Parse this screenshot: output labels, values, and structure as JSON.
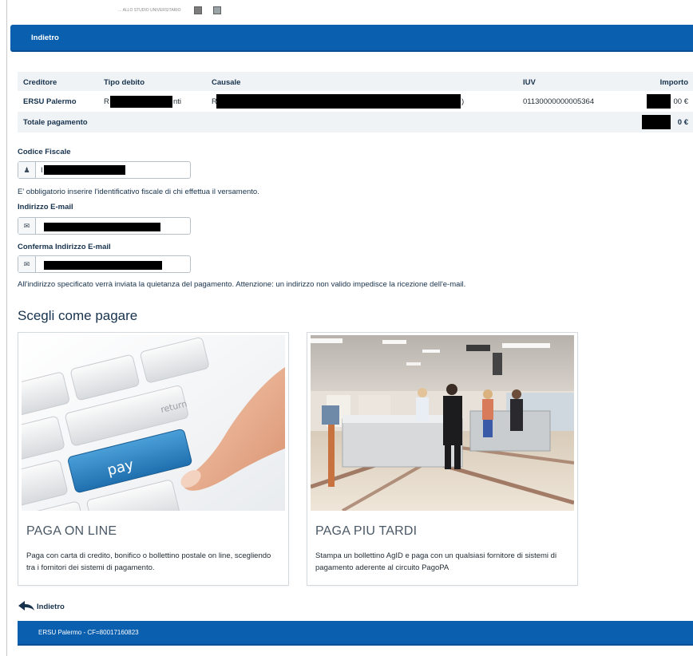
{
  "header": {
    "top_tiny_text": "… ALLO STUDIO UNIVERSITARIO",
    "back_label": "Indietro"
  },
  "payment_table": {
    "columns": [
      "Creditore",
      "Tipo debito",
      "Causale",
      "IUV",
      "Importo"
    ],
    "row": {
      "creditore": "ERSU Palermo",
      "tipo_debito_visible_start": "R",
      "tipo_debito_visible_end": "nti",
      "causale_visible_start": "R",
      "causale_visible_end": ")",
      "iuv": "01130000000005364",
      "importo_visible_end": "00 €"
    },
    "total_label": "Totale pagamento",
    "total_visible_end": "0 €"
  },
  "form": {
    "codice_fiscale_label": "Codice Fiscale",
    "codice_fiscale_value_visible": "I",
    "codice_fiscale_note": "E' obbligatorio inserire l'identificativo fiscale di chi effettua il versamento.",
    "email_label": "Indirizzo E-mail",
    "confirm_email_label": "Conferma Indirizzo E-mail",
    "email_note": "All'indirizzo specificato verrà inviata la quietanza del pagamento. Attenzione: un indirizzo non valido impedisce la ricezione dell'e-mail."
  },
  "payment_choice": {
    "title": "Scegli come pagare",
    "cards": [
      {
        "title": "PAGA ON LINE",
        "description": "Paga con carta di credito, bonifico o bollettino postale on line, scegliendo tra i fornitori dei sistemi di pagamento.",
        "image_text": "pay"
      },
      {
        "title": "PAGA PIU TARDI",
        "description": "Stampa un bollettino AgID e paga con un qualsiasi fornitore di sistemi di pagamento aderente al circuito PagoPA"
      }
    ]
  },
  "footer": {
    "back_label": "Indietro",
    "text": "ERSU Palermo - CF=80017160823"
  },
  "icons": {
    "user": "user-icon",
    "email": "envelope-icon",
    "back": "back-arrow-icon"
  },
  "colors": {
    "primary_blue": "#0a5faf",
    "text_dark": "#17324d",
    "redaction": "#000000"
  }
}
